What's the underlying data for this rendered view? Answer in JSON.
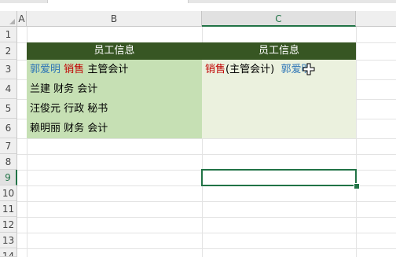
{
  "columns": {
    "a": "A",
    "b": "B",
    "c": "C"
  },
  "rows": [
    "1",
    "2",
    "3",
    "4",
    "5",
    "6",
    "7",
    "8",
    "9",
    "10",
    "11",
    "12",
    "13",
    "14"
  ],
  "header_b": "员工信息",
  "header_c": "员工信息",
  "b3": {
    "name": "郭爱明",
    "dept": "销售",
    "title": "主管会计"
  },
  "b4": "兰建 财务 会计",
  "b5": "汪俊元 行政 秘书",
  "b6": "赖明丽 财务 会计",
  "c3": {
    "dept": "销售",
    "title": "(主管会计)",
    "name": "郭爱明"
  },
  "colors": {
    "header_bg": "#375623",
    "col_b_fill": "#c6e0b4",
    "col_c_fill": "#ebf1de",
    "blue": "#2e75b6",
    "red": "#c00000",
    "selection": "#217346"
  },
  "selected_row": "9",
  "selected_col": "C"
}
